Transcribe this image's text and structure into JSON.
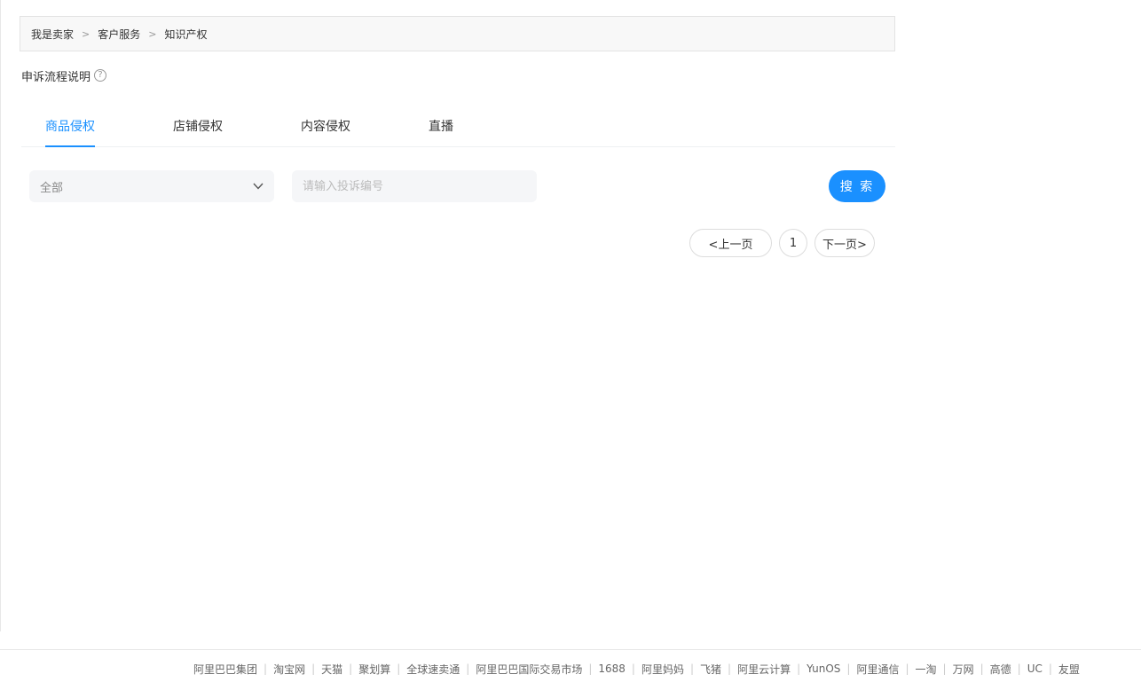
{
  "breadcrumb": {
    "items": [
      "我是卖家",
      "客户服务",
      "知识产权"
    ],
    "separator": ">"
  },
  "appeal": {
    "label": "申诉流程说明",
    "help_icon": "question-circle-icon",
    "help_glyph": "?"
  },
  "tabs": [
    {
      "label": "商品侵权",
      "active": true
    },
    {
      "label": "店铺侵权",
      "active": false
    },
    {
      "label": "内容侵权",
      "active": false
    },
    {
      "label": "直播",
      "active": false
    }
  ],
  "filter": {
    "selected": "全部",
    "chevron_icon": "chevron-down-icon"
  },
  "search": {
    "placeholder": "请输入投诉编号",
    "value": "",
    "button_label": "搜 索"
  },
  "pagination": {
    "prev_label": "<上一页",
    "current_page": "1",
    "next_label": "下一页>"
  },
  "footer": {
    "links": [
      "阿里巴巴集团",
      "淘宝网",
      "天猫",
      "聚划算",
      "全球速卖通",
      "阿里巴巴国际交易市场",
      "1688",
      "阿里妈妈",
      "飞猪",
      "阿里云计算",
      "YunOS",
      "阿里通信",
      "一淘",
      "万网",
      "高德",
      "UC",
      "友盟"
    ],
    "separator": "|"
  },
  "colors": {
    "accent": "#1a90ff",
    "input_bg": "#f5f6f8",
    "breadcrumb_bg": "#f8f8f8"
  }
}
